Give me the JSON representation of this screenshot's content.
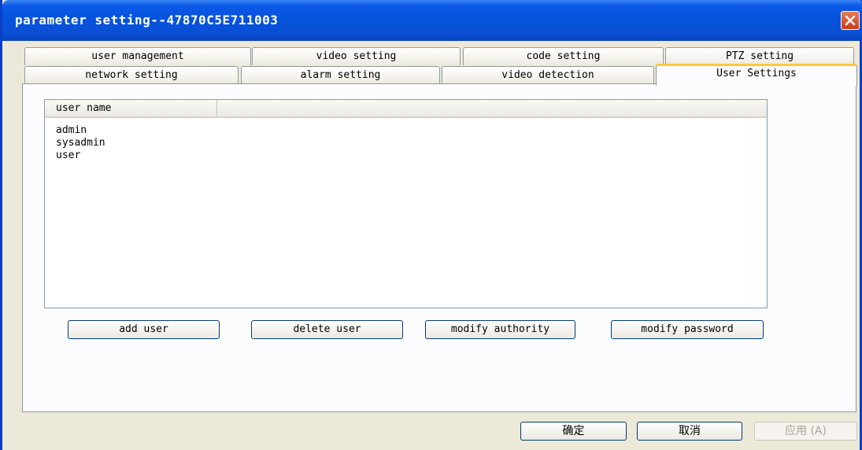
{
  "window": {
    "title": "parameter setting--47870C5E711003"
  },
  "tabs_row1": [
    {
      "label": "user management"
    },
    {
      "label": "video setting"
    },
    {
      "label": "code setting"
    },
    {
      "label": "PTZ setting"
    }
  ],
  "tabs_row2": [
    {
      "label": "network setting"
    },
    {
      "label": "alarm setting"
    },
    {
      "label": "video detection"
    },
    {
      "label": "User Settings",
      "active": true
    }
  ],
  "user_list": {
    "column_header": "user name",
    "rows": [
      "admin",
      "sysadmin",
      "user"
    ]
  },
  "actions": {
    "add_user": "add user",
    "delete_user": "delete user",
    "modify_authority": "modify authority",
    "modify_password": "modify password"
  },
  "footer": {
    "ok": "确定",
    "cancel": "取消",
    "apply": "应用 (A)"
  }
}
